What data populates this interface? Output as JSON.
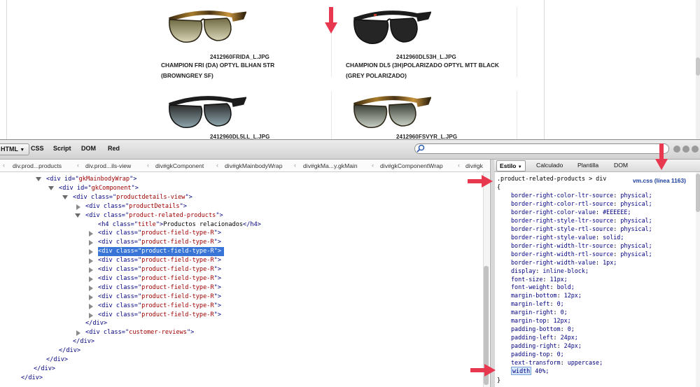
{
  "page": {
    "products": [
      {
        "file": "2412960FRIDA_L.JPG",
        "name_line1": "CHAMPION FRI (DA) OPTYL BLHAN STR",
        "name_line2": "(BROWNGREY SF)"
      },
      {
        "file": "2412960DL53H_L.JPG",
        "name_line1": "CHAMPION DL5 (3H)POLARIZADO OPTYL MTT BLACK",
        "name_line2": "(GREY POLARIZADO)"
      },
      {
        "file": "2412960DL5LL_L.JPG"
      },
      {
        "file": "2412960FSVYR_L.JPG"
      }
    ]
  },
  "firebug": {
    "tabs": [
      "HTML",
      "CSS",
      "Script",
      "DOM",
      "Red"
    ],
    "breadcrumb": [
      "div.prod...products",
      "div.prod...ils-view",
      "div#gkComponent",
      "div#gkMainbodyWrap",
      "div#gkMa...y.gkMain",
      "div#gkComponentWrap",
      "div#gk"
    ],
    "tree": [
      {
        "open": true,
        "tag": "div",
        "attr": "id",
        "val": "gkMainbodyWrap"
      },
      {
        "open": true,
        "tag": "div",
        "attr": "id",
        "val": "gkComponent"
      },
      {
        "open": true,
        "tag": "div",
        "attr": "class",
        "val": "productdetails-view"
      },
      {
        "open": false,
        "tag": "div",
        "attr": "class",
        "val": "productDetails"
      },
      {
        "open": true,
        "tag": "div",
        "attr": "class",
        "val": "product-related-products"
      },
      {
        "none": true,
        "tag": "h4",
        "attr": "class",
        "val": "title",
        "text": "Productos relacionados",
        "close": "h4"
      },
      {
        "open": false,
        "tag": "div",
        "attr": "class",
        "val": "product-field-type-R"
      },
      {
        "open": false,
        "tag": "div",
        "attr": "class",
        "val": "product-field-type-R"
      },
      {
        "open": false,
        "tag": "div",
        "attr": "class",
        "val": "product-field-type-R",
        "selected": true
      },
      {
        "open": false,
        "tag": "div",
        "attr": "class",
        "val": "product-field-type-R"
      },
      {
        "open": false,
        "tag": "div",
        "attr": "class",
        "val": "product-field-type-R"
      },
      {
        "open": false,
        "tag": "div",
        "attr": "class",
        "val": "product-field-type-R"
      },
      {
        "open": false,
        "tag": "div",
        "attr": "class",
        "val": "product-field-type-R"
      },
      {
        "open": false,
        "tag": "div",
        "attr": "class",
        "val": "product-field-type-R"
      },
      {
        "open": false,
        "tag": "div",
        "attr": "class",
        "val": "product-field-type-R"
      },
      {
        "open": false,
        "tag": "div",
        "attr": "class",
        "val": "product-field-type-R"
      },
      {
        "closing": "div"
      },
      {
        "open": false,
        "tag": "div",
        "attr": "class",
        "val": "customer-reviews"
      },
      {
        "closing": "div"
      },
      {
        "closing": "div"
      },
      {
        "closing": "div"
      },
      {
        "closing": "div"
      },
      {
        "closing": "div"
      }
    ],
    "side_tabs": [
      "Estilo",
      "Calculado",
      "Plantilla",
      "DOM"
    ],
    "style": {
      "selector": ".product-related-products > div",
      "source_link": "vm.css (línea 1163)",
      "open_brace": "{",
      "close_brace": "}",
      "rules": [
        {
          "prop": "border-right-color-ltr-source",
          "val": "physical;"
        },
        {
          "prop": "border-right-color-rtl-source",
          "val": "physical;"
        },
        {
          "prop": "border-right-color-value",
          "val": "#EEEEEE;"
        },
        {
          "prop": "border-right-style-ltr-source",
          "val": "physical;"
        },
        {
          "prop": "border-right-style-rtl-source",
          "val": "physical;"
        },
        {
          "prop": "border-right-style-value",
          "val": "solid;"
        },
        {
          "prop": "border-right-width-ltr-source",
          "val": "physical;"
        },
        {
          "prop": "border-right-width-rtl-source",
          "val": "physical;"
        },
        {
          "prop": "border-right-width-value",
          "val": "1px;"
        },
        {
          "prop": "display",
          "val": "inline-block;"
        },
        {
          "prop": "font-size",
          "val": "11px;"
        },
        {
          "prop": "font-weight",
          "val": "bold;"
        },
        {
          "prop": "margin-bottom",
          "val": "12px;"
        },
        {
          "prop": "margin-left",
          "val": "0;"
        },
        {
          "prop": "margin-right",
          "val": "0;"
        },
        {
          "prop": "margin-top",
          "val": "12px;"
        },
        {
          "prop": "padding-bottom",
          "val": "0;"
        },
        {
          "prop": "padding-left",
          "val": "24px;"
        },
        {
          "prop": "padding-right",
          "val": "24px;"
        },
        {
          "prop": "padding-top",
          "val": "0;"
        },
        {
          "prop": "text-transform",
          "val": "uppercase;"
        },
        {
          "prop": "width",
          "val": "40%;",
          "editing": true
        }
      ]
    }
  },
  "colors": {
    "arrow": "#e8384f",
    "selection": "#3875d7"
  }
}
